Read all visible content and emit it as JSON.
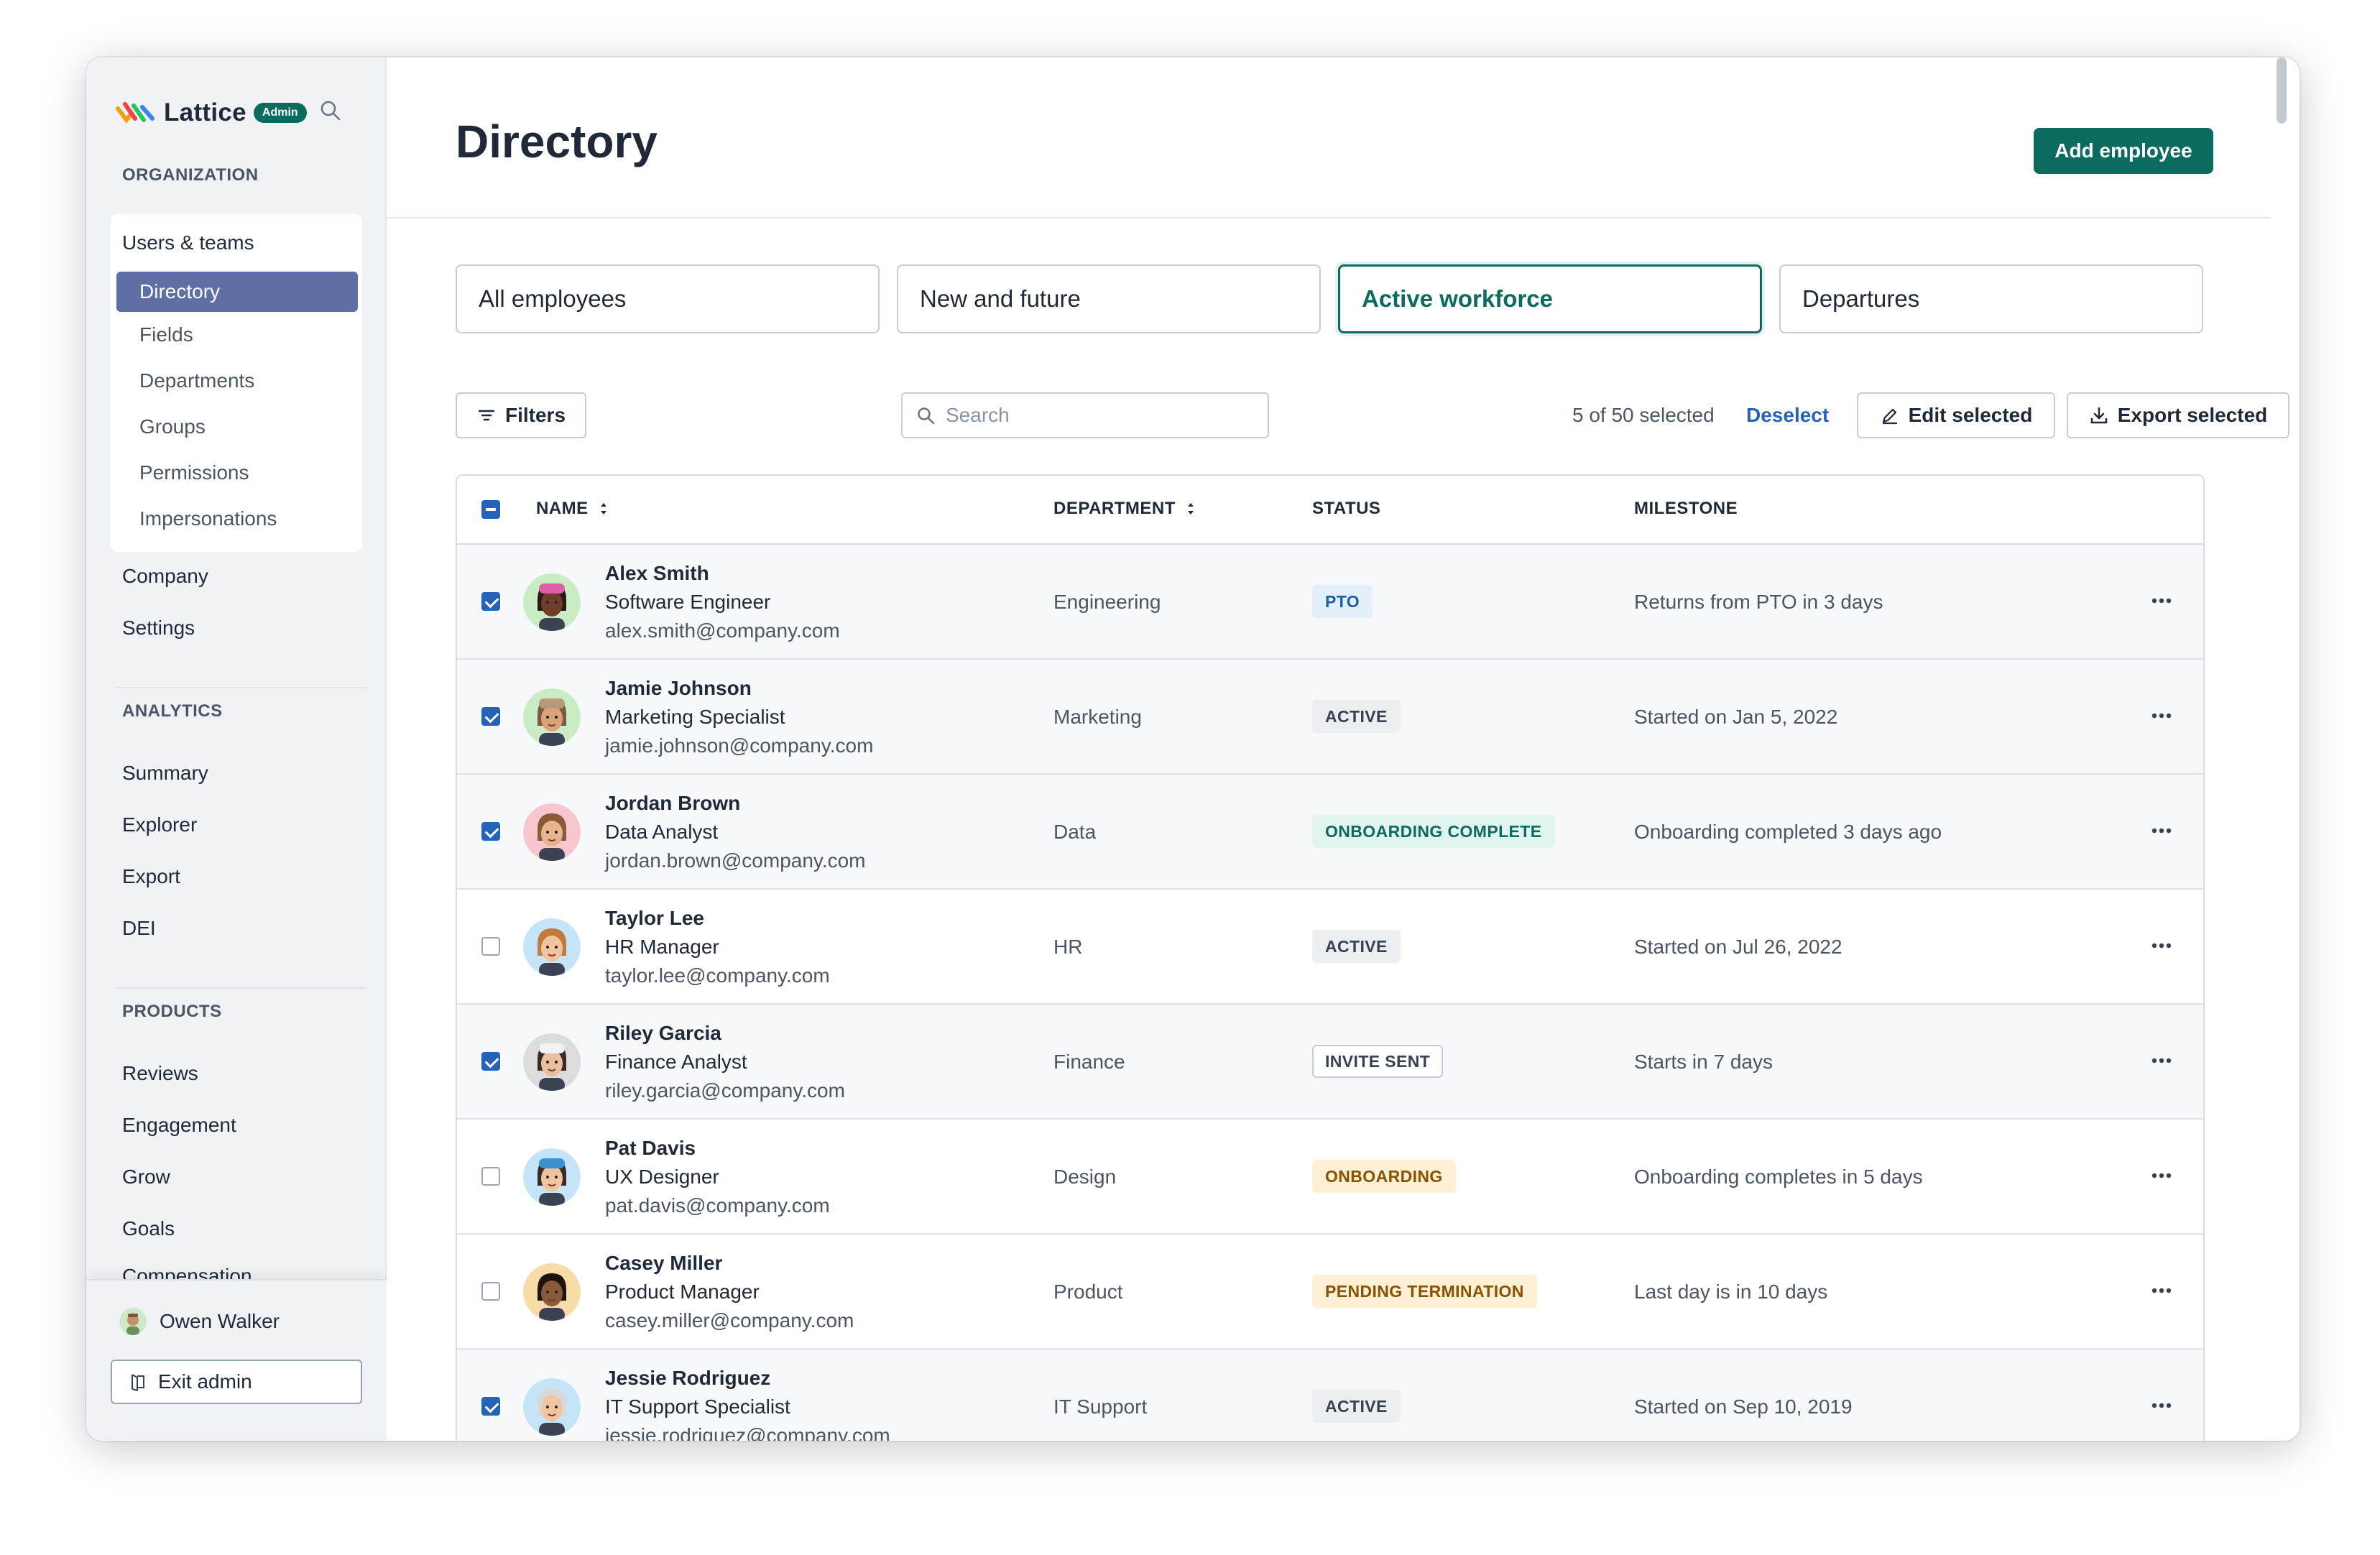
{
  "app": {
    "name": "Lattice",
    "role_badge": "Admin",
    "accent_color": "#0a6b5e",
    "link_color": "#2563b8"
  },
  "sidebar": {
    "org_label": "ORGANIZATION",
    "users_teams": "Users & teams",
    "sub_items": [
      "Directory",
      "Fields",
      "Departments",
      "Groups",
      "Permissions",
      "Impersonations"
    ],
    "company": "Company",
    "settings": "Settings",
    "analytics_label": "ANALYTICS",
    "analytics_items": [
      "Summary",
      "Explorer",
      "Export",
      "DEI"
    ],
    "products_label": "PRODUCTS",
    "products_items": [
      "Reviews",
      "Engagement",
      "Grow",
      "Goals",
      "Compensation"
    ],
    "user_name": "Owen Walker",
    "exit_admin": "Exit admin"
  },
  "page": {
    "title": "Directory",
    "add_button": "Add employee",
    "tabs": [
      "All employees",
      "New and future",
      "Active workforce",
      "Departures"
    ],
    "active_tab": "Active workforce"
  },
  "toolbar": {
    "filters": "Filters",
    "search_placeholder": "Search",
    "selection_count": "5 of 50 selected",
    "deselect": "Deselect",
    "edit_selected": "Edit selected",
    "export_selected": "Export selected"
  },
  "table": {
    "headers": {
      "name": "NAME",
      "department": "DEPARTMENT",
      "status": "STATUS",
      "milestone": "MILESTONE"
    },
    "rows": [
      {
        "name": "Alex Smith",
        "title": "Software Engineer",
        "email": "alex.smith@company.com",
        "department": "Engineering",
        "status": "PTO",
        "milestone": "Returns from PTO in 3 days",
        "selected": true
      },
      {
        "name": "Jamie Johnson",
        "title": "Marketing Specialist",
        "email": "jamie.johnson@company.com",
        "department": "Marketing",
        "status": "ACTIVE",
        "milestone": "Started on Jan 5, 2022",
        "selected": true
      },
      {
        "name": "Jordan Brown",
        "title": "Data Analyst",
        "email": "jordan.brown@company.com",
        "department": "Data",
        "status": "ONBOARDING COMPLETE",
        "milestone": "Onboarding completed 3 days ago",
        "selected": true
      },
      {
        "name": "Taylor Lee",
        "title": "HR Manager",
        "email": "taylor.lee@company.com",
        "department": "HR",
        "status": "ACTIVE",
        "milestone": "Started on Jul 26, 2022",
        "selected": false
      },
      {
        "name": "Riley Garcia",
        "title": "Finance Analyst",
        "email": "riley.garcia@company.com",
        "department": "Finance",
        "status": "INVITE SENT",
        "milestone": "Starts in 7 days",
        "selected": true
      },
      {
        "name": "Pat Davis",
        "title": "UX Designer",
        "email": "pat.davis@company.com",
        "department": "Design",
        "status": "ONBOARDING",
        "milestone": "Onboarding completes in 5 days",
        "selected": false
      },
      {
        "name": "Casey Miller",
        "title": "Product Manager",
        "email": "casey.miller@company.com",
        "department": "Product",
        "status": "PENDING TERMINATION",
        "milestone": "Last day is in 10 days",
        "selected": false
      },
      {
        "name": "Jessie Rodriguez",
        "title": "IT Support Specialist",
        "email": "jessie.rodriguez@company.com",
        "department": "IT Support",
        "status": "ACTIVE",
        "milestone": "Started on Sep 10, 2019",
        "selected": true
      }
    ]
  },
  "status_colors": {
    "PTO": {
      "bg": "#e3f0fb",
      "fg": "#1d5fa8",
      "border": "#e3f0fb"
    },
    "ACTIVE": {
      "bg": "#eceef1",
      "fg": "#374151",
      "border": "#eceef1"
    },
    "ONBOARDING COMPLETE": {
      "bg": "#e2f4ee",
      "fg": "#0a6b5e",
      "border": "#e2f4ee"
    },
    "INVITE SENT": {
      "bg": "#ffffff",
      "fg": "#374151",
      "border": "#c7ccd4"
    },
    "ONBOARDING": {
      "bg": "#fdf0d5",
      "fg": "#8a5200",
      "border": "#fdf0d5"
    },
    "PENDING TERMINATION": {
      "bg": "#fdf0d5",
      "fg": "#8a5200",
      "border": "#fdf0d5"
    }
  },
  "avatars": [
    {
      "bg": "#c9ecc4",
      "skin": "#6b3f2a",
      "hair": "#2a1a12",
      "hat": "#e05ca6"
    },
    {
      "bg": "#c9ecc4",
      "skin": "#d9a27a",
      "hair": "#7a5a3a",
      "hat": "#b89a7a"
    },
    {
      "bg": "#f7c6cf",
      "skin": "#e8b48e",
      "hair": "#8a5a38",
      "hat": ""
    },
    {
      "bg": "#c6e4f7",
      "skin": "#f0c49e",
      "hair": "#c07a3a",
      "hat": ""
    },
    {
      "bg": "#dcdcdc",
      "skin": "#e8c0a0",
      "hair": "#3a2a22",
      "hat": "#f2f2f2"
    },
    {
      "bg": "#c6e4f7",
      "skin": "#f0c49e",
      "hair": "#3a2a22",
      "hat": "#3a8fd0"
    },
    {
      "bg": "#f9dba8",
      "skin": "#8a5a3a",
      "hair": "#1f140e",
      "hat": ""
    },
    {
      "bg": "#c6e4f7",
      "skin": "#f0c49e",
      "hair": "#d8d8d8",
      "hat": ""
    }
  ]
}
